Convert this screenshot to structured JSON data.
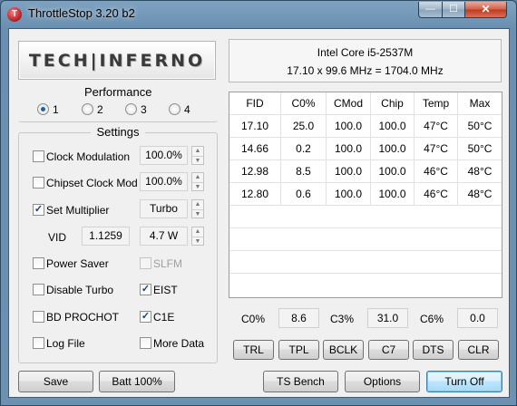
{
  "window": {
    "title": "ThrottleStop 3.20 b2",
    "app_icon_letter": "T",
    "minimize_glyph": "—",
    "maximize_glyph": "☐",
    "close_glyph": "✕"
  },
  "logo": {
    "text": "TECH|INFERNO"
  },
  "cpu": {
    "name": "Intel Core i5-2537M",
    "frequency": "17.10 x 99.6 MHz = 1704.0 MHz"
  },
  "performance": {
    "label": "Performance",
    "options": [
      "1",
      "2",
      "3",
      "4"
    ],
    "selected": "1"
  },
  "settings": {
    "label": "Settings",
    "clock_modulation": {
      "label": "Clock Modulation",
      "checked": false,
      "value": "100.0%"
    },
    "chipset_clock_mod": {
      "label": "Chipset Clock Mod",
      "checked": false,
      "value": "100.0%"
    },
    "set_multiplier": {
      "label": "Set Multiplier",
      "checked": true,
      "value": "Turbo"
    },
    "vid": {
      "label": "VID",
      "value": "1.1259",
      "watts": "4.7 W"
    },
    "power_saver": {
      "label": "Power Saver",
      "checked": false
    },
    "slfm": {
      "label": "SLFM",
      "checked": false,
      "disabled": true
    },
    "disable_turbo": {
      "label": "Disable Turbo",
      "checked": false
    },
    "eist": {
      "label": "EIST",
      "checked": true
    },
    "bd_prochot": {
      "label": "BD PROCHOT",
      "checked": false
    },
    "c1e": {
      "label": "C1E",
      "checked": true
    },
    "log_file": {
      "label": "Log File",
      "checked": false
    },
    "more_data": {
      "label": "More Data",
      "checked": false
    },
    "check_glyph": "✓",
    "spin_up_glyph": "▲",
    "spin_down_glyph": "▼"
  },
  "table": {
    "headers": [
      "FID",
      "C0%",
      "CMod",
      "Chip",
      "Temp",
      "Max"
    ],
    "rows": [
      [
        "17.10",
        "25.0",
        "100.0",
        "100.0",
        "47°C",
        "50°C"
      ],
      [
        "14.66",
        "0.2",
        "100.0",
        "100.0",
        "47°C",
        "50°C"
      ],
      [
        "12.98",
        "8.5",
        "100.0",
        "100.0",
        "46°C",
        "48°C"
      ],
      [
        "12.80",
        "0.6",
        "100.0",
        "100.0",
        "46°C",
        "48°C"
      ]
    ]
  },
  "cstates": {
    "c0_label": "C0%",
    "c0_value": "8.6",
    "c3_label": "C3%",
    "c3_value": "31.0",
    "c6_label": "C6%",
    "c6_value": "0.0"
  },
  "tool_buttons": [
    "TRL",
    "TPL",
    "BCLK",
    "C7",
    "DTS",
    "CLR"
  ],
  "bottom_buttons": {
    "save": "Save",
    "batt": "Batt 100%",
    "ts_bench": "TS Bench",
    "options": "Options",
    "turn_off": "Turn Off"
  }
}
